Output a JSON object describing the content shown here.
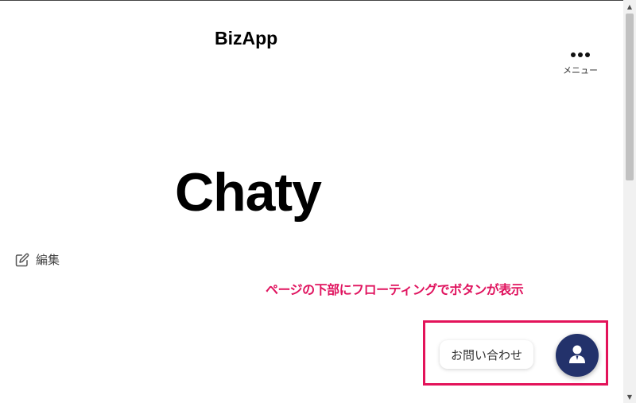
{
  "header": {
    "site_title": "BizApp",
    "menu_label": "メニュー"
  },
  "main": {
    "hero_title": "Chaty",
    "edit_label": "編集"
  },
  "annotation": {
    "text": "ページの下部にフローティングでボタンが表示",
    "color": "#e0145f"
  },
  "floating_widget": {
    "contact_label": "お問い合わせ",
    "button_color": "#23326b",
    "highlight_color": "#e3135a"
  },
  "icons": {
    "menu": "more-horizontal-icon",
    "edit": "pencil-square-icon",
    "contact": "person-icon"
  }
}
